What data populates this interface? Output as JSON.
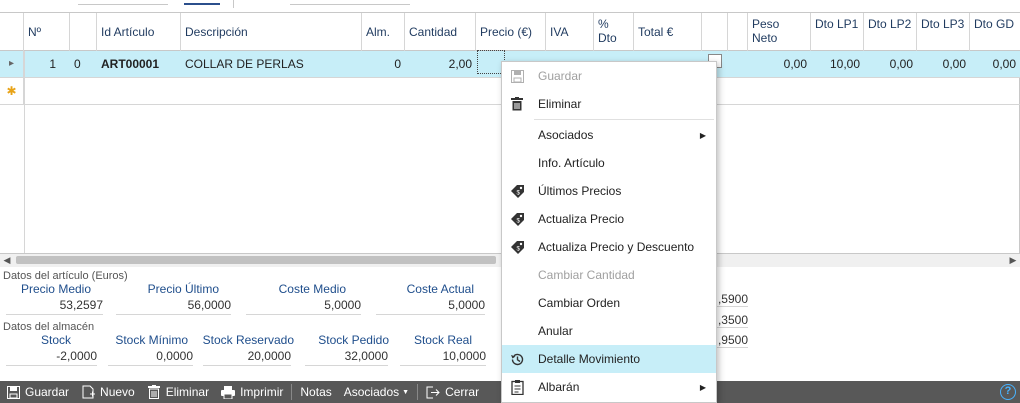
{
  "grid": {
    "columns": [
      "Nº",
      "Id Artículo",
      "Descripción",
      "Alm.",
      "Cantidad",
      "Precio (€)",
      "IVA",
      "% Dto",
      "Total €",
      "Peso Neto",
      "Dto LP1",
      "Dto LP2",
      "Dto LP3",
      "Dto GD"
    ],
    "rows": [
      {
        "num_a": "1",
        "num_b": "0",
        "id": "ART00001",
        "descripcion": "COLLAR DE PERLAS",
        "alm": "0",
        "cantidad": "2,00",
        "peso_neto": "0,00",
        "dto_lp1": "10,00",
        "dto_lp2": "0,00",
        "dto_lp3": "0,00",
        "dto_gd": "0,00"
      }
    ]
  },
  "info": {
    "articulo_title": "Datos del artículo (Euros)",
    "precio_medio_label": "Precio Medio",
    "precio_medio": "53,2597",
    "precio_ultimo_label": "Precio Último",
    "precio_ultimo": "56,0000",
    "coste_medio_label": "Coste Medio",
    "coste_medio": "5,0000",
    "coste_actual_label": "Coste Actual",
    "coste_actual": "5,0000",
    "almacen_title": "Datos del almacén",
    "stock_label": "Stock",
    "stock": "-2,0000",
    "stock_minimo_label": "Stock Mínimo",
    "stock_minimo": "0,0000",
    "stock_reservado_label": "Stock Reservado",
    "stock_reservado": "20,0000",
    "stock_pedido_label": "Stock Pedido",
    "stock_pedido": "32,0000",
    "stock_real_label": "Stock Real",
    "stock_real": "10,0000",
    "right_values": [
      ",5900",
      ",3500",
      ",9500"
    ]
  },
  "toolbar": {
    "guardar": "Guardar",
    "nuevo": "Nuevo",
    "eliminar": "Eliminar",
    "imprimir": "Imprimir",
    "notas": "Notas",
    "asociados": "Asociados",
    "cerrar": "Cerrar",
    "help": "?"
  },
  "menu": {
    "items": [
      {
        "label": "Guardar",
        "icon": "save-icon",
        "disabled": true
      },
      {
        "label": "Eliminar",
        "icon": "trash-icon",
        "disabled": false
      },
      {
        "label": "Asociados",
        "icon": "",
        "disabled": false,
        "submenu": true
      },
      {
        "label": "Info. Artículo",
        "icon": "",
        "disabled": false
      },
      {
        "label": "Últimos Precios",
        "icon": "price-tag-icon",
        "disabled": false
      },
      {
        "label": "Actualiza Precio",
        "icon": "price-tag-icon",
        "disabled": false
      },
      {
        "label": "Actualiza Precio y Descuento",
        "icon": "price-tag-icon",
        "disabled": false
      },
      {
        "label": "Cambiar Cantidad",
        "icon": "",
        "disabled": true
      },
      {
        "label": "Cambiar Orden",
        "icon": "",
        "disabled": false
      },
      {
        "label": "Anular",
        "icon": "",
        "disabled": false
      },
      {
        "label": "Detalle Movimiento",
        "icon": "history-icon",
        "disabled": false,
        "highlighted": true
      },
      {
        "label": "Albarán",
        "icon": "document-icon",
        "disabled": false,
        "submenu": true
      }
    ]
  },
  "colors": {
    "selection": "#c7eef8",
    "toolbar": "#585858",
    "header_text": "#1f3a5f",
    "label_blue": "#1f4e8c"
  }
}
